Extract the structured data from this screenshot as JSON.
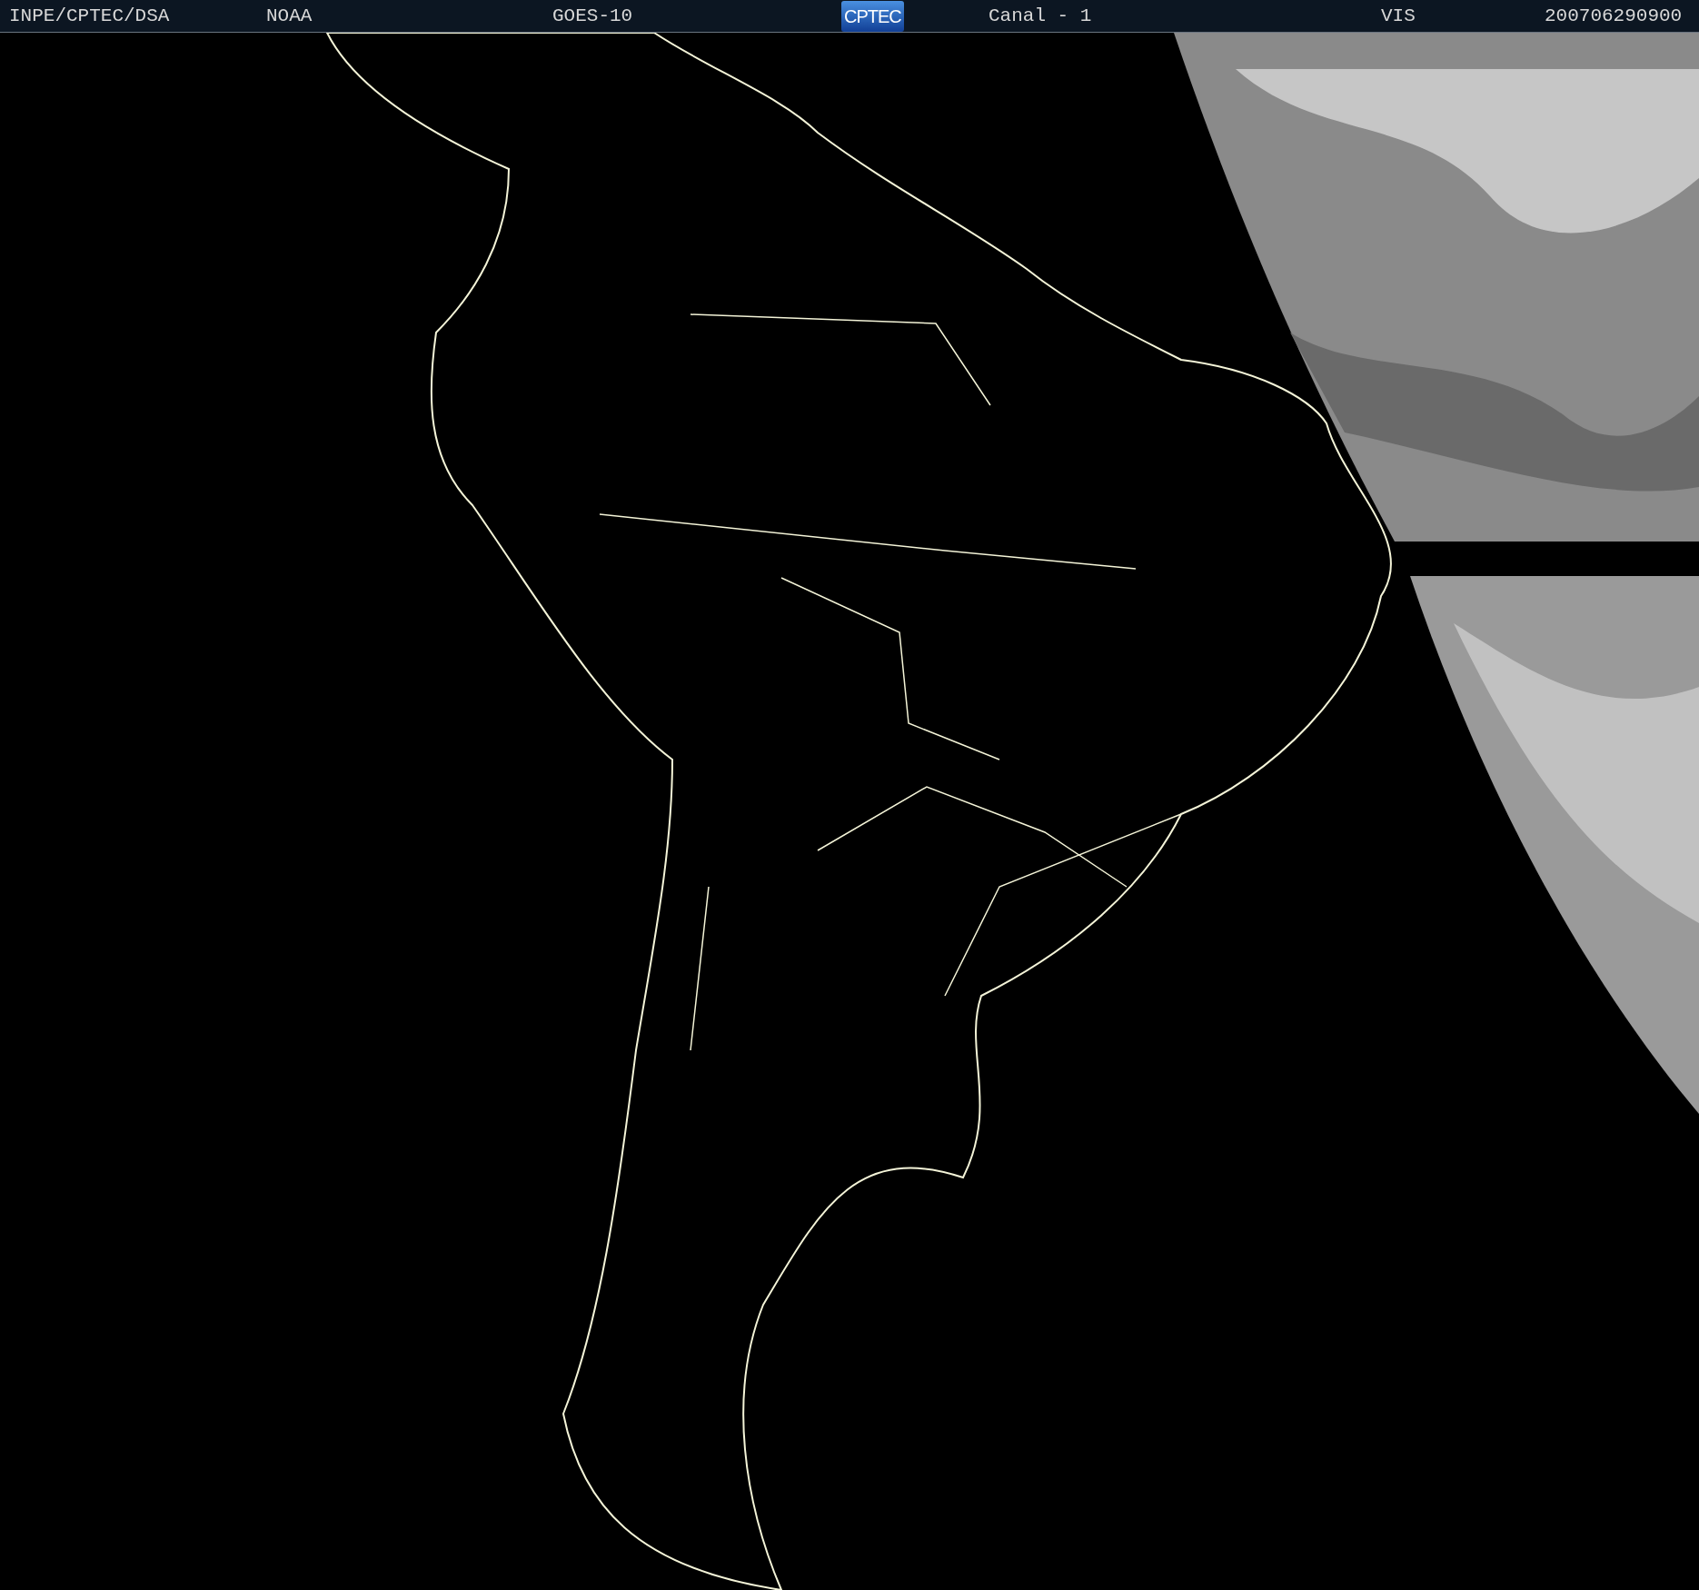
{
  "header": {
    "items": [
      {
        "kind": "text",
        "text": "INPE/CPTEC/DSA"
      },
      {
        "kind": "text",
        "text": "NOAA"
      },
      {
        "kind": "text",
        "text": "GOES-10"
      },
      {
        "kind": "logo",
        "text": "CPTEC"
      },
      {
        "kind": "text",
        "text": "Canal - 1"
      },
      {
        "kind": "text",
        "text": "VIS"
      },
      {
        "kind": "text",
        "text": "200706290900"
      }
    ]
  }
}
